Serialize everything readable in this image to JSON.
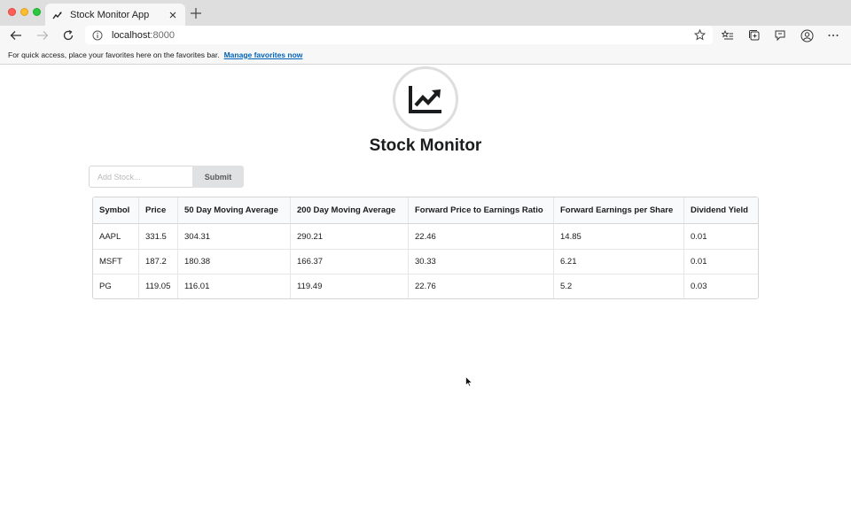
{
  "browser": {
    "tab_title": "Stock Monitor App",
    "address_host": "localhost",
    "address_port": ":8000",
    "favorites_text": "For quick access, place your favorites here on the favorites bar.",
    "favorites_link": "Manage favorites now"
  },
  "app": {
    "title": "Stock Monitor",
    "logo_icon": "chart-line-up-icon"
  },
  "form": {
    "placeholder": "Add Stock...",
    "value": "",
    "submit_label": "Submit"
  },
  "table": {
    "headers": [
      "Symbol",
      "Price",
      "50 Day Moving Average",
      "200 Day Moving Average",
      "Forward Price to Earnings Ratio",
      "Forward Earnings per Share",
      "Dividend Yield"
    ],
    "rows": [
      [
        "AAPL",
        "331.5",
        "304.31",
        "290.21",
        "22.46",
        "14.85",
        "0.01"
      ],
      [
        "MSFT",
        "187.2",
        "180.38",
        "166.37",
        "30.33",
        "6.21",
        "0.01"
      ],
      [
        "PG",
        "119.05",
        "116.01",
        "119.49",
        "22.76",
        "5.2",
        "0.03"
      ]
    ]
  },
  "colors": {
    "favorites_link": "#0062b8",
    "button_bg": "#e0e1e2",
    "table_header_bg": "#f9fafb"
  }
}
